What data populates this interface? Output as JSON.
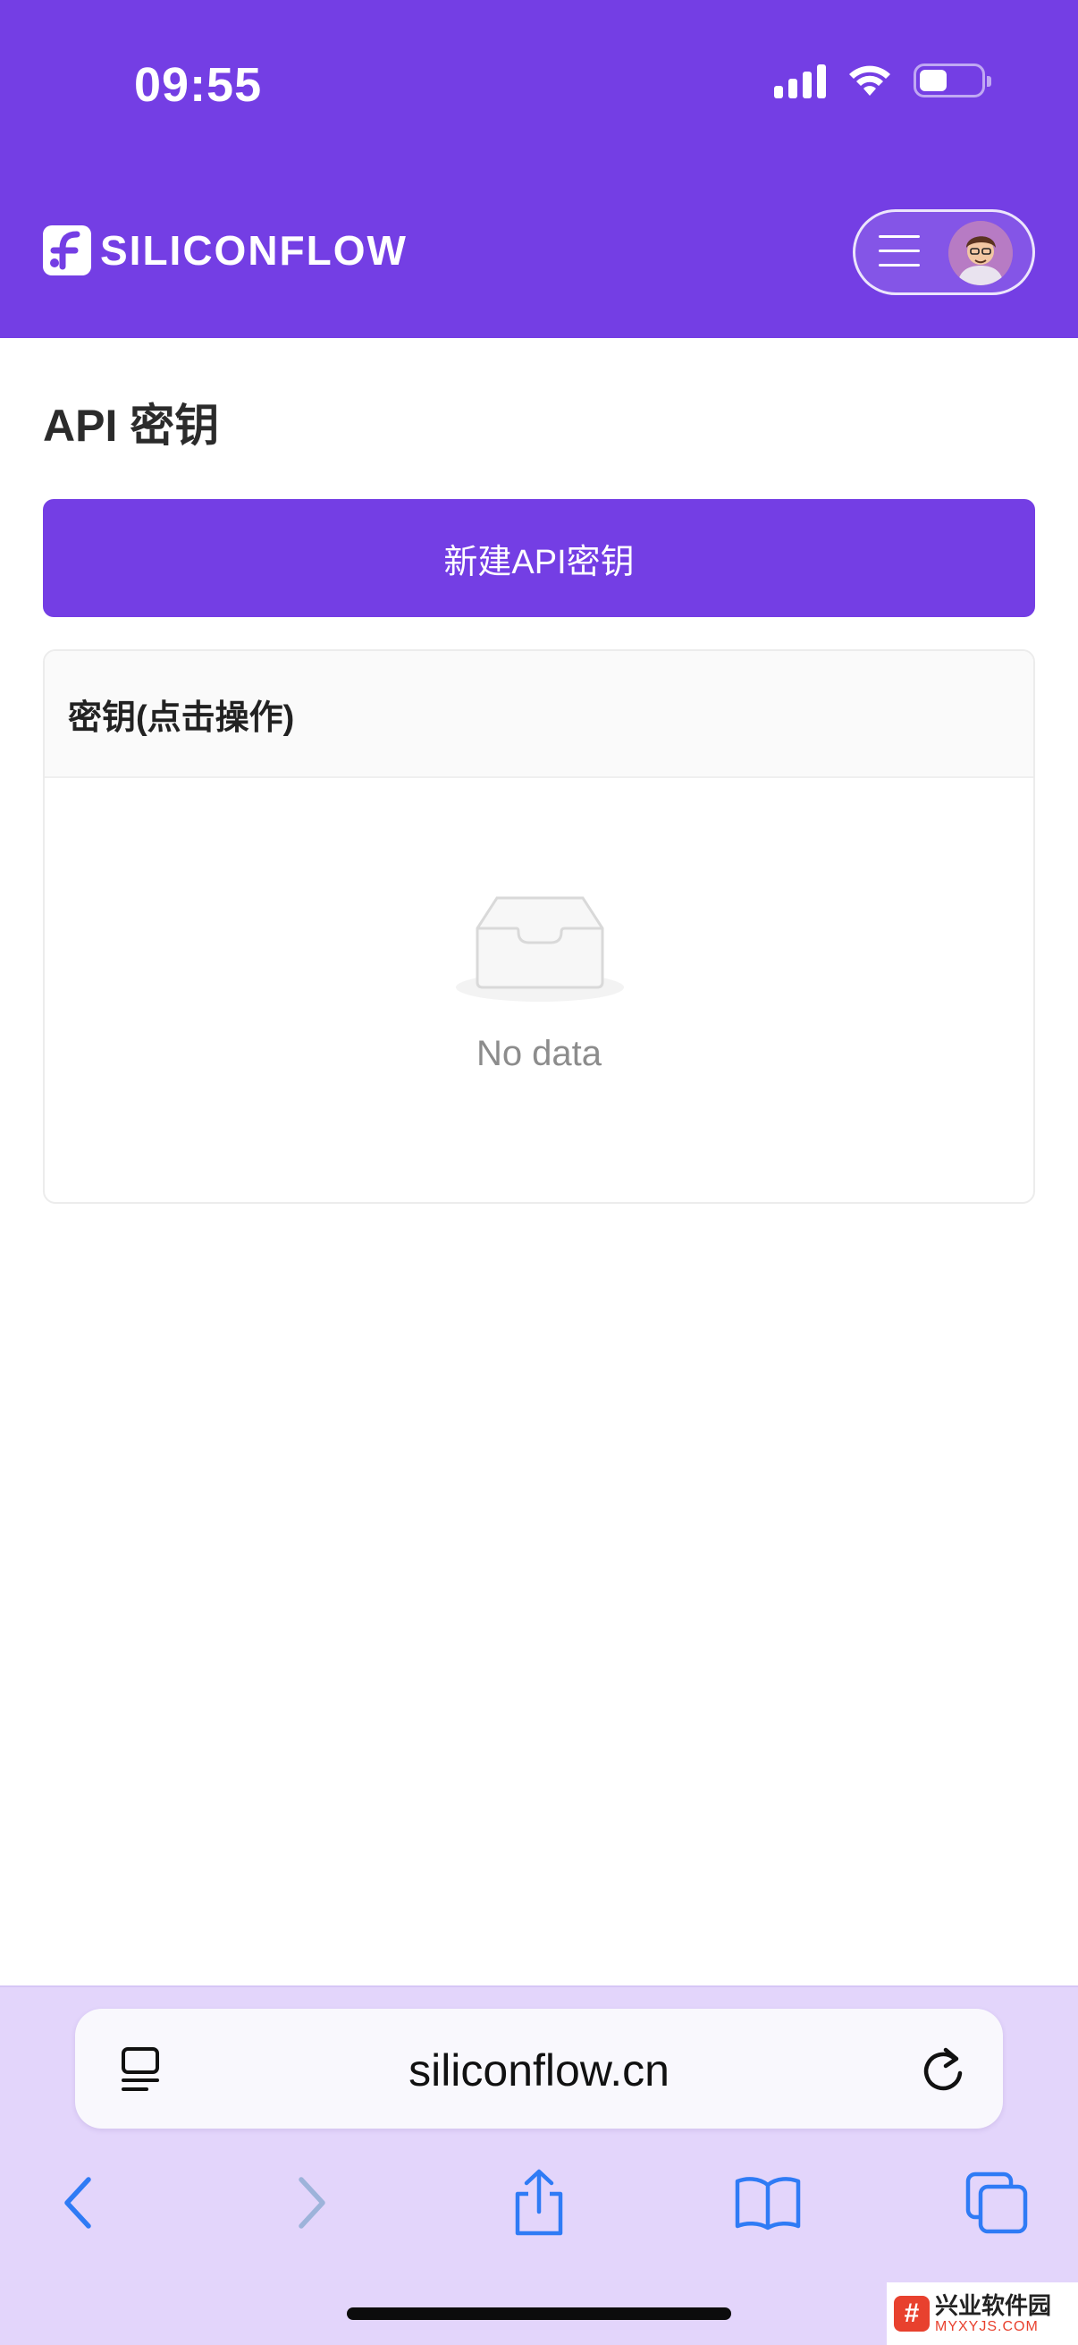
{
  "status_bar": {
    "time": "09:55"
  },
  "header": {
    "brand": "SILICONFLOW",
    "brand_color": "#743ee4"
  },
  "page": {
    "title": "API 密钥",
    "new_key_button": "新建API密钥"
  },
  "table": {
    "columns": [
      "密钥(点击操作)"
    ],
    "empty_text": "No data"
  },
  "browser": {
    "url": "siliconflow.cn",
    "toolbar_icons": [
      "back-icon",
      "forward-icon",
      "share-icon",
      "bookmarks-icon",
      "tabs-icon"
    ]
  },
  "watermark": {
    "mark": "#",
    "name": "兴业软件园",
    "domain": "MYXYJS.COM"
  }
}
